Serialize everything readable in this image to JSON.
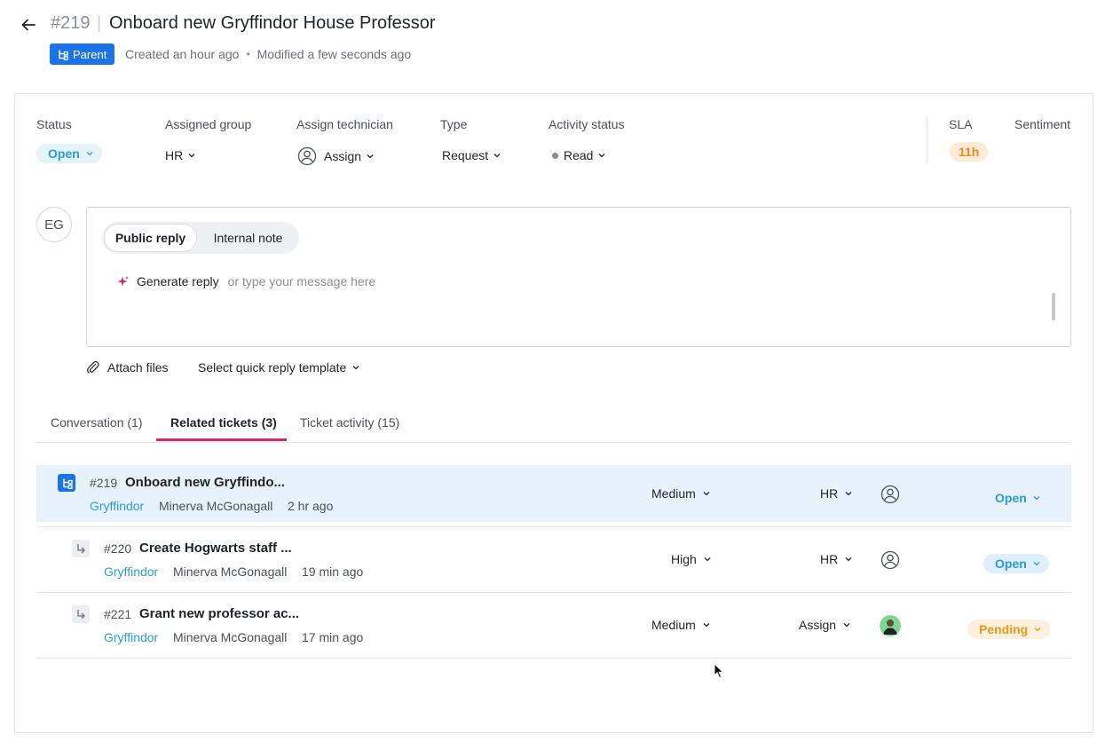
{
  "header": {
    "ticket_number": "#219",
    "separator": "|",
    "title": "Onboard new Gryffindor House Professor",
    "parent_badge": "Parent",
    "created": "Created an hour ago",
    "dot": "•",
    "modified": "Modified a few seconds ago"
  },
  "properties": {
    "status": {
      "label": "Status",
      "value": "Open"
    },
    "assigned_group": {
      "label": "Assigned group",
      "value": "HR"
    },
    "assign_technician": {
      "label": "Assign technician",
      "value": "Assign"
    },
    "type": {
      "label": "Type",
      "value": "Request"
    },
    "activity_status": {
      "label": "Activity status",
      "value": "Read"
    },
    "sla": {
      "label": "SLA",
      "value": "11h"
    },
    "sentiment": {
      "label": "Sentiment"
    }
  },
  "composer": {
    "avatar_initials": "EG",
    "tabs": [
      "Public reply",
      "Internal note"
    ],
    "generate_reply": "Generate reply",
    "placeholder": "or type your message here",
    "attach_files": "Attach files",
    "quick_reply": "Select quick reply template"
  },
  "tabs": [
    {
      "label": "Conversation (1)"
    },
    {
      "label": "Related tickets (3)"
    },
    {
      "label": "Ticket activity (15)"
    }
  ],
  "related_tickets": [
    {
      "number": "#219",
      "title": "Onboard new Gryffindo...",
      "group": "Gryffindor",
      "requester": "Minerva McGonagall",
      "time": "2 hr ago",
      "priority": "Medium",
      "assigned_group": "HR",
      "technician": "",
      "status": "Open"
    },
    {
      "number": "#220",
      "title": "Create Hogwarts staff ...",
      "group": "Gryffindor",
      "requester": "Minerva McGonagall",
      "time": "19 min ago",
      "priority": "High",
      "assigned_group": "HR",
      "technician": "",
      "status": "Open"
    },
    {
      "number": "#221",
      "title": "Grant new professor ac...",
      "group": "Gryffindor",
      "requester": "Minerva McGonagall",
      "time": "17 min ago",
      "priority": "Medium",
      "assigned_group": "Assign",
      "technician": "avatar",
      "status": "Pending"
    }
  ],
  "colors": {
    "brand_blue": "#1a73e8",
    "open_blue": "#2a9bd8",
    "pending_orange": "#e59a1c",
    "sla_orange": "#e58a22",
    "tab_accent": "#d6246e",
    "row_highlight": "#e8f2fd"
  },
  "icons": {
    "back": "arrow-left-icon",
    "parent": "hierarchy-icon",
    "child": "sub-arrow-icon",
    "generate": "sparkle-icon",
    "attach": "paperclip-icon",
    "user": "user-circle-icon",
    "chevron": "chevron-down-icon"
  }
}
